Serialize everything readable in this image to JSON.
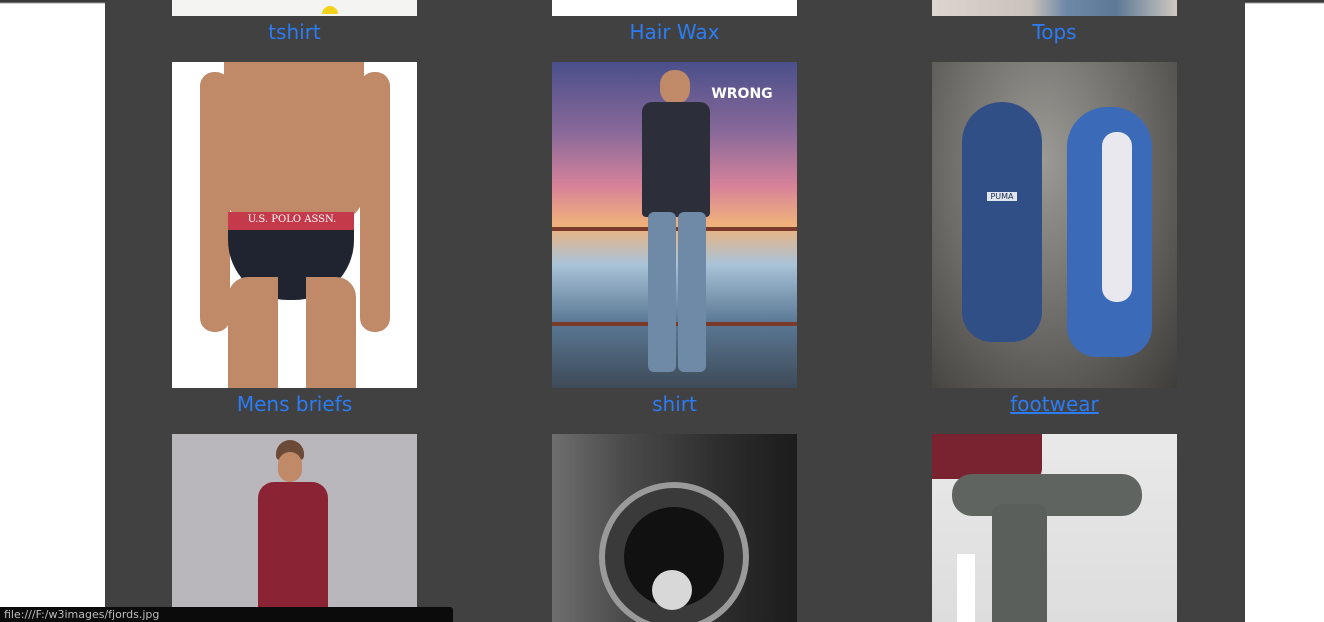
{
  "gallery": {
    "items": [
      {
        "label": "tshirt",
        "photo_alt": "tshirt"
      },
      {
        "label": "Hair Wax",
        "photo_alt": "Hair Wax"
      },
      {
        "label": "Tops",
        "photo_alt": "Tops"
      },
      {
        "label": "Mens briefs",
        "photo_alt": "Mens briefs"
      },
      {
        "label": "shirt",
        "photo_alt": "shirt"
      },
      {
        "label": "footwear",
        "photo_alt": "footwear"
      },
      {
        "label": "",
        "photo_alt": "dress"
      },
      {
        "label": "",
        "photo_alt": "watch"
      },
      {
        "label": "",
        "photo_alt": "jeans"
      }
    ],
    "photo_text": {
      "briefs_band": "U.S. POLO ASSN.",
      "shirt_brand": "WRONG",
      "shoe_brand": "PUMA"
    }
  },
  "status_bar": {
    "url": "file:///F:/w3images/fjords.jpg"
  },
  "colors": {
    "page_background": "#ffffff",
    "gallery_background": "#414141",
    "link": "#2b7cf5",
    "status_bar_background": "#0b0b0b"
  }
}
